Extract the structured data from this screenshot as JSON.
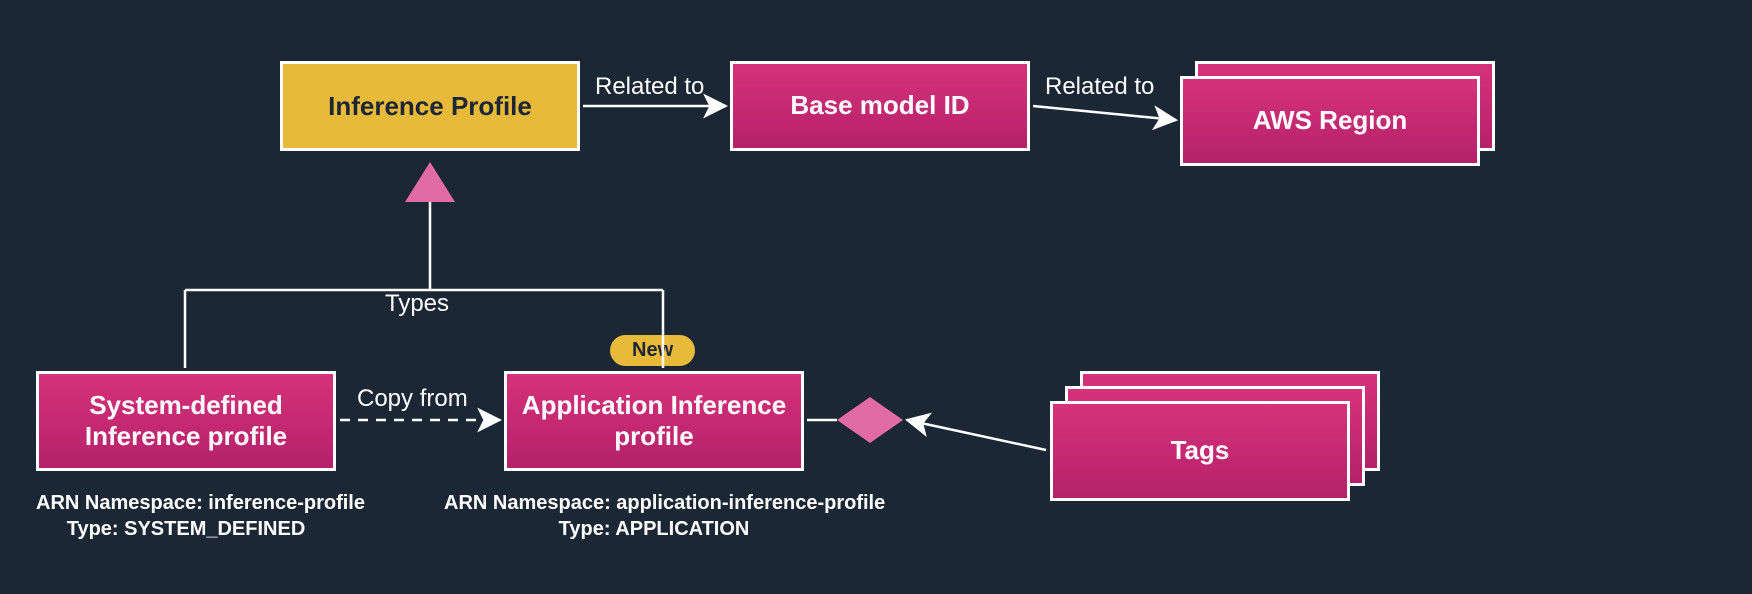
{
  "nodes": {
    "inference_profile": "Inference Profile",
    "base_model_id": "Base model ID",
    "aws_region": "AWS Region",
    "system_defined": "System-defined\nInference profile",
    "application_inference": "Application Inference\nprofile",
    "tags": "Tags"
  },
  "edges": {
    "related_to_1": "Related to",
    "related_to_2": "Related to",
    "types": "Types",
    "copy_from": "Copy from"
  },
  "badges": {
    "new": "New"
  },
  "meta": {
    "system_defined_line1": "ARN Namespace: inference-profile",
    "system_defined_line2": "Type: SYSTEM_DEFINED",
    "application_line1": "ARN Namespace: application-inference-profile",
    "application_line2": "Type: APPLICATION"
  },
  "colors": {
    "bg": "#1b2735",
    "pink": "#d6327a",
    "pink_light": "#e06ba5",
    "yellow": "#e9b93a",
    "white": "#ffffff"
  }
}
